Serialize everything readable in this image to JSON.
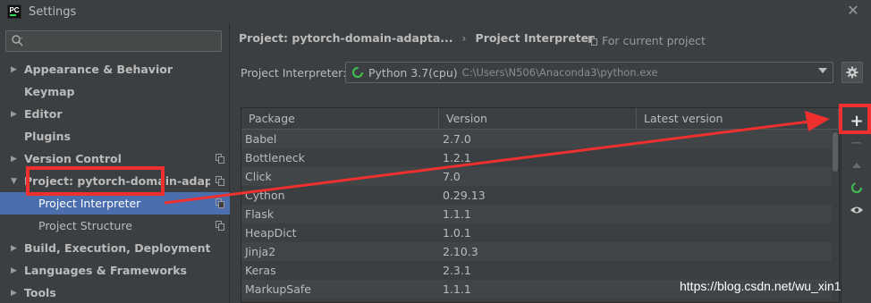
{
  "window": {
    "title": "Settings",
    "logo_text": "PC"
  },
  "search": {
    "placeholder": "",
    "value": ""
  },
  "sidebar": {
    "items": [
      {
        "label": "Appearance & Behavior",
        "expandable": true,
        "expanded": false
      },
      {
        "label": "Keymap",
        "expandable": false
      },
      {
        "label": "Editor",
        "expandable": true,
        "expanded": false
      },
      {
        "label": "Plugins",
        "expandable": false
      },
      {
        "label": "Version Control",
        "expandable": true,
        "expanded": false,
        "has_copy": true
      },
      {
        "label": "Project: pytorch-domain-adapta...",
        "expandable": true,
        "expanded": true,
        "has_copy": true
      },
      {
        "label": "Project Interpreter",
        "sub": true,
        "selected": true,
        "has_copy": true
      },
      {
        "label": "Project Structure",
        "sub": true,
        "has_copy": true
      },
      {
        "label": "Build, Execution, Deployment",
        "expandable": true,
        "expanded": false
      },
      {
        "label": "Languages & Frameworks",
        "expandable": true,
        "expanded": false
      },
      {
        "label": "Tools",
        "expandable": true,
        "expanded": false
      }
    ]
  },
  "breadcrumb": {
    "project": "Project: pytorch-domain-adapta...",
    "separator": "›",
    "page": "Project Interpreter"
  },
  "scope": {
    "label": "For current project"
  },
  "interpreter": {
    "label": "Project Interpreter:",
    "name": "Python 3.7(cpu)",
    "path": "C:\\Users\\N506\\Anaconda3\\python.exe"
  },
  "table": {
    "headers": [
      "Package",
      "Version",
      "Latest version"
    ],
    "rows": [
      {
        "package": "Babel",
        "version": "2.7.0",
        "latest": ""
      },
      {
        "package": "Bottleneck",
        "version": "1.2.1",
        "latest": ""
      },
      {
        "package": "Click",
        "version": "7.0",
        "latest": ""
      },
      {
        "package": "Cython",
        "version": "0.29.13",
        "latest": ""
      },
      {
        "package": "Flask",
        "version": "1.1.1",
        "latest": ""
      },
      {
        "package": "HeapDict",
        "version": "1.0.1",
        "latest": ""
      },
      {
        "package": "Jinja2",
        "version": "2.10.3",
        "latest": ""
      },
      {
        "package": "Keras",
        "version": "2.3.1",
        "latest": ""
      },
      {
        "package": "MarkupSafe",
        "version": "1.1.1",
        "latest": ""
      }
    ]
  },
  "toolbar": {
    "add": "+",
    "remove": "−"
  },
  "watermark": "https://blog.csdn.net/wu_xin1",
  "colors": {
    "accent": "#4b6eaf",
    "annotation": "#f0302e",
    "spinner": "#3fb950"
  }
}
